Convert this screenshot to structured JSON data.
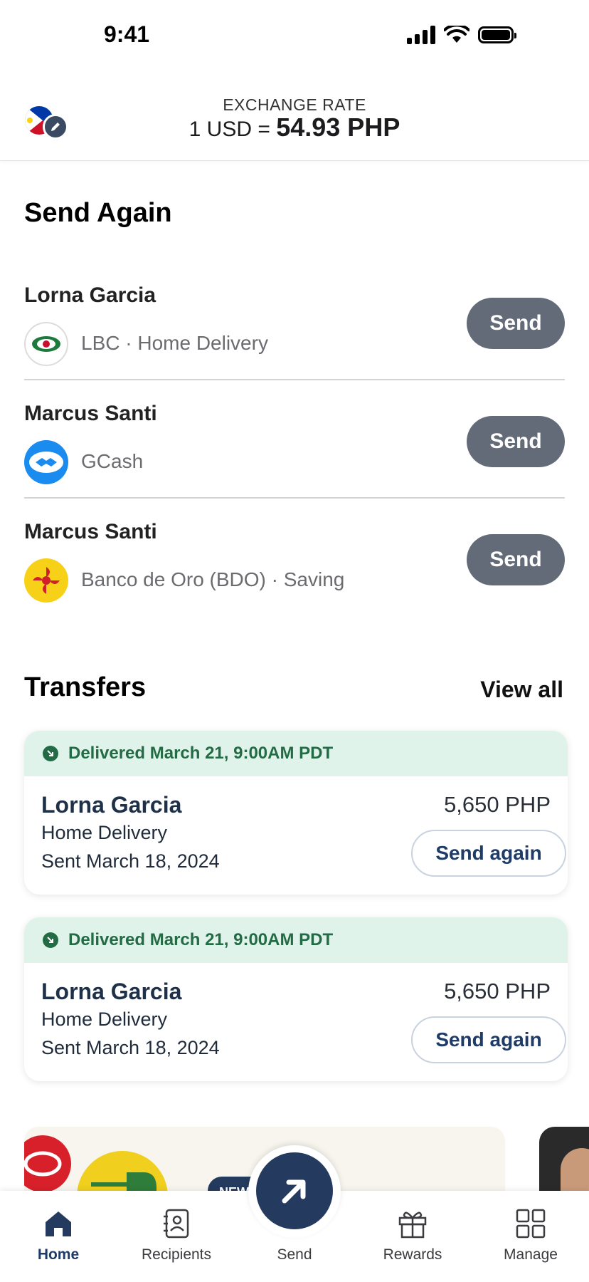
{
  "status_bar": {
    "time": "9:41"
  },
  "header": {
    "flag_icon": "philippines-flag-icon",
    "rate_label": "EXCHANGE RATE",
    "rate_prefix": "1 USD = ",
    "rate_value": "54.93 PHP"
  },
  "send_again": {
    "title": "Send Again",
    "button_label": "Send",
    "recipients": [
      {
        "name": "Lorna Garcia",
        "detail": "LBC · Home Delivery",
        "logo": "lbc-logo-icon"
      },
      {
        "name": "Marcus Santi",
        "detail": "GCash",
        "logo": "gcash-logo-icon"
      },
      {
        "name": "Marcus Santi",
        "detail": "Banco de Oro (BDO) · Saving",
        "logo": "bdo-logo-icon"
      }
    ]
  },
  "transfers": {
    "title": "Transfers",
    "view_all": "View all",
    "items": [
      {
        "status": "Delivered March 21, 9:00AM PDT",
        "name": "Lorna Garcia",
        "method": "Home Delivery",
        "date": "Sent March 18, 2024",
        "amount": "5,650 PHP",
        "action": "Send again"
      },
      {
        "status": "Delivered March 21, 9:00AM PDT",
        "name": "Lorna Garcia",
        "method": "Home Delivery",
        "date": "Sent March 18, 2024",
        "amount": "5,650 PHP",
        "action": "Send again"
      }
    ]
  },
  "promo": {
    "badge": "NEW"
  },
  "nav": {
    "home": "Home",
    "recipients": "Recipients",
    "send": "Send",
    "rewards": "Rewards",
    "manage": "Manage"
  },
  "colors": {
    "primary": "#243a5e",
    "send_button": "#636b78",
    "delivered_bg": "#e0f3ea",
    "delivered_text": "#236b45"
  }
}
